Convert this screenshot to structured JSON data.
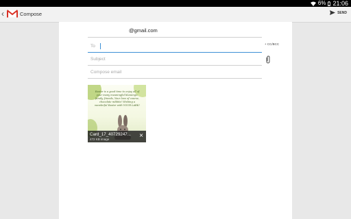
{
  "status_bar": {
    "battery": "6%",
    "time": "21:06"
  },
  "action_bar": {
    "title": "Compose",
    "send_label": "SEND"
  },
  "compose": {
    "from": "@gmail.com",
    "to_placeholder": "To",
    "cc_bcc_label": "+ CC/BCC",
    "subject_placeholder": "Subject",
    "body_placeholder": "Compose email"
  },
  "attachment": {
    "card_text": "Easter is a good time to enjoy all of your many meaningful blessings: family, friends, Your love of course, chocolate rabbits! Wishing a wonderful Easter with YOUR LARK!",
    "file_name": "Card_17_40729247...",
    "file_size": "472 KB image"
  },
  "colors": {
    "accent": "#3b8fd6",
    "gmail_red": "#d93025"
  }
}
